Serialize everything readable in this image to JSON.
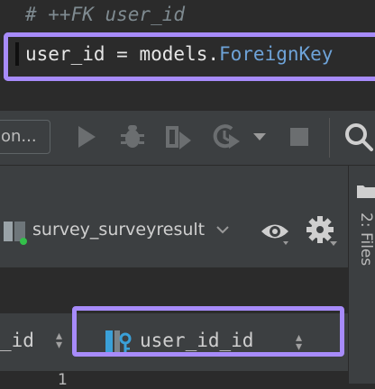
{
  "editor": {
    "comment": "# ++FK user_id",
    "code_var": "user_id",
    "code_op": "=",
    "code_module": "models.",
    "code_class": "ForeignKey"
  },
  "toolbar": {
    "run_config_label": "on...",
    "icons": [
      "run-icon",
      "debug-icon",
      "coverage-icon",
      "profile-icon",
      "dropdown-icon",
      "stop-icon",
      "search-icon"
    ]
  },
  "side_panel": {
    "files_label": "2: Files"
  },
  "db_view": {
    "table_name": "survey_surveyresult",
    "left_column_partial": "_id",
    "selected_column": "user_id_id",
    "row_number": "1"
  },
  "colors": {
    "highlight": "#a78bfa",
    "fk_class": "#6ea3d8"
  }
}
